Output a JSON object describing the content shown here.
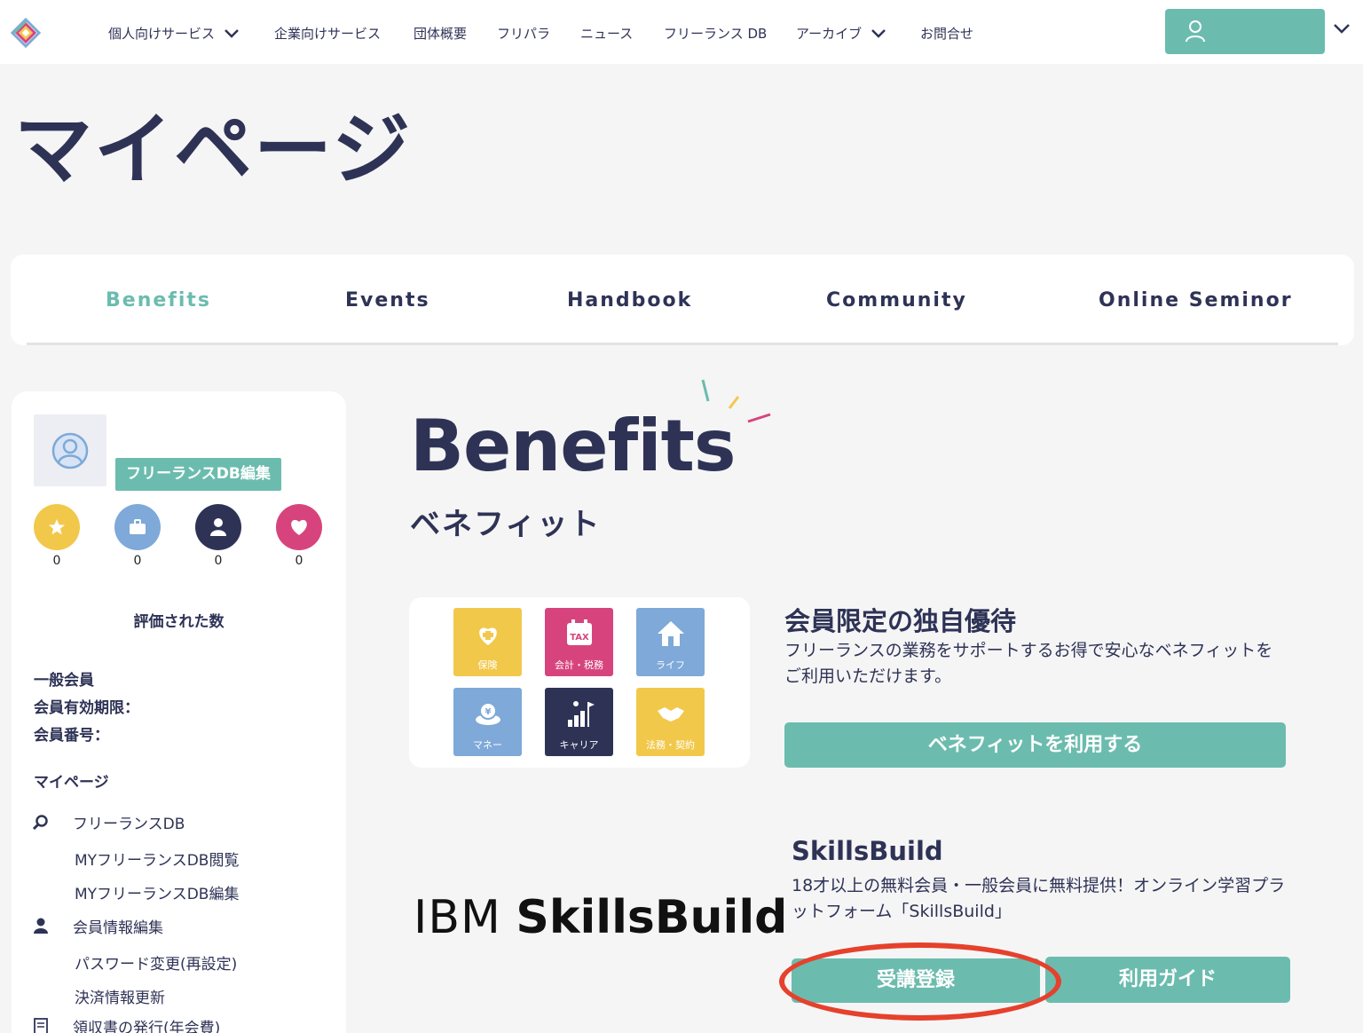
{
  "nav": {
    "items": [
      "個人向けサービス",
      "企業向けサービス",
      "団体概要",
      "フリパラ",
      "ニュース",
      "フリーランス DB",
      "アーカイブ",
      "お問合せ"
    ],
    "user_name": "・・・・"
  },
  "page": {
    "title": "マイページ"
  },
  "tabs": [
    "Benefits",
    "Events",
    "Handbook",
    "Community",
    "Online Seminor"
  ],
  "sidebar": {
    "edit_label": "フリーランスDB編集",
    "stats": [
      {
        "icon": "star-icon",
        "color": "#f2c84b",
        "count": "0"
      },
      {
        "icon": "briefcase-icon",
        "color": "#7ea9d8",
        "count": "0"
      },
      {
        "icon": "person-icon",
        "color": "#2e3356",
        "count": "0"
      },
      {
        "icon": "heart-icon",
        "color": "#d7447d",
        "count": "0"
      }
    ],
    "rating_label": "評価された数",
    "member_type": "一般会員",
    "expiry_label": "会員有効期限：",
    "number_label": "会員番号：",
    "mypage_label": "マイページ",
    "links": {
      "db": "フリーランスDB",
      "db_view": "MYフリーランスDB閲覧",
      "db_edit": "MYフリーランスDB編集",
      "member_edit": "会員情報編集",
      "password": "パスワード変更(再設定)",
      "payment": "決済情報更新",
      "receipt": "領収書の発行(年会費)"
    }
  },
  "main": {
    "heading": "Benefits",
    "subheading": "ベネフィット",
    "tiles": [
      {
        "label": "保険",
        "color": "#f2c84b",
        "icon": "insurance-icon"
      },
      {
        "label": "会計・税務",
        "color": "#d7447d",
        "icon": "tax-icon"
      },
      {
        "label": "ライフ",
        "color": "#7ea9d8",
        "icon": "house-icon"
      },
      {
        "label": "マネー",
        "color": "#7ea9d8",
        "icon": "money-icon"
      },
      {
        "label": "キャリア",
        "color": "#2e3356",
        "icon": "career-icon"
      },
      {
        "label": "法務・契約",
        "color": "#f2c84b",
        "icon": "handshake-icon"
      }
    ],
    "benefit_section": {
      "title": "会員限定の独自優待",
      "desc": "フリーランスの業務をサポートするお得で安心なベネフィットをご利用いただけます。",
      "button": "ベネフィットを利用する"
    },
    "skills_section": {
      "logo_ibm": "IBM",
      "logo_skills": "SkillsBuild",
      "title": "SkillsBuild",
      "desc": "18才以上の無料会員・一般会員に無料提供！オンライン学習プラットフォーム「SkillsBuild」",
      "register_button": "受講登録",
      "guide_button": "利用ガイド"
    }
  },
  "colors": {
    "accent": "#6bbcae",
    "navy": "#2e3356",
    "highlight": "#e5412c"
  }
}
